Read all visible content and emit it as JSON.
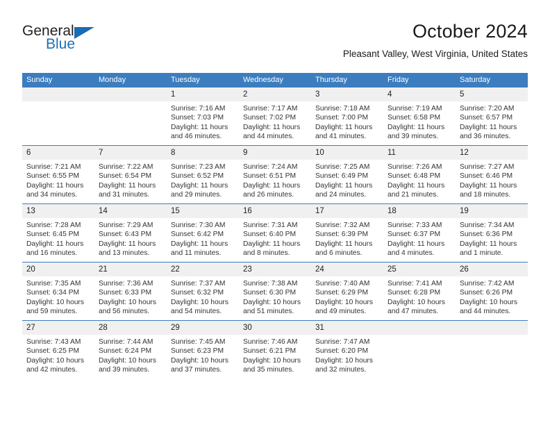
{
  "brand": {
    "name_top": "General",
    "name_bottom": "Blue",
    "triangle_icon": "blue-triangle-logo-icon",
    "accent_color": "#1b6cb3"
  },
  "header": {
    "title": "October 2024",
    "subtitle": "Pleasant Valley, West Virginia, United States"
  },
  "calendar": {
    "header_bg": "#3b7dbf",
    "daynum_bg": "#f0f0f0",
    "weekdays": [
      "Sunday",
      "Monday",
      "Tuesday",
      "Wednesday",
      "Thursday",
      "Friday",
      "Saturday"
    ],
    "weeks": [
      [
        {
          "day": "",
          "empty": true,
          "l1": "",
          "l2": "",
          "l3": "",
          "l4": ""
        },
        {
          "day": "",
          "empty": true,
          "l1": "",
          "l2": "",
          "l3": "",
          "l4": ""
        },
        {
          "day": "1",
          "l1": "Sunrise: 7:16 AM",
          "l2": "Sunset: 7:03 PM",
          "l3": "Daylight: 11 hours",
          "l4": "and 46 minutes."
        },
        {
          "day": "2",
          "l1": "Sunrise: 7:17 AM",
          "l2": "Sunset: 7:02 PM",
          "l3": "Daylight: 11 hours",
          "l4": "and 44 minutes."
        },
        {
          "day": "3",
          "l1": "Sunrise: 7:18 AM",
          "l2": "Sunset: 7:00 PM",
          "l3": "Daylight: 11 hours",
          "l4": "and 41 minutes."
        },
        {
          "day": "4",
          "l1": "Sunrise: 7:19 AM",
          "l2": "Sunset: 6:58 PM",
          "l3": "Daylight: 11 hours",
          "l4": "and 39 minutes."
        },
        {
          "day": "5",
          "l1": "Sunrise: 7:20 AM",
          "l2": "Sunset: 6:57 PM",
          "l3": "Daylight: 11 hours",
          "l4": "and 36 minutes."
        }
      ],
      [
        {
          "day": "6",
          "l1": "Sunrise: 7:21 AM",
          "l2": "Sunset: 6:55 PM",
          "l3": "Daylight: 11 hours",
          "l4": "and 34 minutes."
        },
        {
          "day": "7",
          "l1": "Sunrise: 7:22 AM",
          "l2": "Sunset: 6:54 PM",
          "l3": "Daylight: 11 hours",
          "l4": "and 31 minutes."
        },
        {
          "day": "8",
          "l1": "Sunrise: 7:23 AM",
          "l2": "Sunset: 6:52 PM",
          "l3": "Daylight: 11 hours",
          "l4": "and 29 minutes."
        },
        {
          "day": "9",
          "l1": "Sunrise: 7:24 AM",
          "l2": "Sunset: 6:51 PM",
          "l3": "Daylight: 11 hours",
          "l4": "and 26 minutes."
        },
        {
          "day": "10",
          "l1": "Sunrise: 7:25 AM",
          "l2": "Sunset: 6:49 PM",
          "l3": "Daylight: 11 hours",
          "l4": "and 24 minutes."
        },
        {
          "day": "11",
          "l1": "Sunrise: 7:26 AM",
          "l2": "Sunset: 6:48 PM",
          "l3": "Daylight: 11 hours",
          "l4": "and 21 minutes."
        },
        {
          "day": "12",
          "l1": "Sunrise: 7:27 AM",
          "l2": "Sunset: 6:46 PM",
          "l3": "Daylight: 11 hours",
          "l4": "and 18 minutes."
        }
      ],
      [
        {
          "day": "13",
          "l1": "Sunrise: 7:28 AM",
          "l2": "Sunset: 6:45 PM",
          "l3": "Daylight: 11 hours",
          "l4": "and 16 minutes."
        },
        {
          "day": "14",
          "l1": "Sunrise: 7:29 AM",
          "l2": "Sunset: 6:43 PM",
          "l3": "Daylight: 11 hours",
          "l4": "and 13 minutes."
        },
        {
          "day": "15",
          "l1": "Sunrise: 7:30 AM",
          "l2": "Sunset: 6:42 PM",
          "l3": "Daylight: 11 hours",
          "l4": "and 11 minutes."
        },
        {
          "day": "16",
          "l1": "Sunrise: 7:31 AM",
          "l2": "Sunset: 6:40 PM",
          "l3": "Daylight: 11 hours",
          "l4": "and 8 minutes."
        },
        {
          "day": "17",
          "l1": "Sunrise: 7:32 AM",
          "l2": "Sunset: 6:39 PM",
          "l3": "Daylight: 11 hours",
          "l4": "and 6 minutes."
        },
        {
          "day": "18",
          "l1": "Sunrise: 7:33 AM",
          "l2": "Sunset: 6:37 PM",
          "l3": "Daylight: 11 hours",
          "l4": "and 4 minutes."
        },
        {
          "day": "19",
          "l1": "Sunrise: 7:34 AM",
          "l2": "Sunset: 6:36 PM",
          "l3": "Daylight: 11 hours",
          "l4": "and 1 minute."
        }
      ],
      [
        {
          "day": "20",
          "l1": "Sunrise: 7:35 AM",
          "l2": "Sunset: 6:34 PM",
          "l3": "Daylight: 10 hours",
          "l4": "and 59 minutes."
        },
        {
          "day": "21",
          "l1": "Sunrise: 7:36 AM",
          "l2": "Sunset: 6:33 PM",
          "l3": "Daylight: 10 hours",
          "l4": "and 56 minutes."
        },
        {
          "day": "22",
          "l1": "Sunrise: 7:37 AM",
          "l2": "Sunset: 6:32 PM",
          "l3": "Daylight: 10 hours",
          "l4": "and 54 minutes."
        },
        {
          "day": "23",
          "l1": "Sunrise: 7:38 AM",
          "l2": "Sunset: 6:30 PM",
          "l3": "Daylight: 10 hours",
          "l4": "and 51 minutes."
        },
        {
          "day": "24",
          "l1": "Sunrise: 7:40 AM",
          "l2": "Sunset: 6:29 PM",
          "l3": "Daylight: 10 hours",
          "l4": "and 49 minutes."
        },
        {
          "day": "25",
          "l1": "Sunrise: 7:41 AM",
          "l2": "Sunset: 6:28 PM",
          "l3": "Daylight: 10 hours",
          "l4": "and 47 minutes."
        },
        {
          "day": "26",
          "l1": "Sunrise: 7:42 AM",
          "l2": "Sunset: 6:26 PM",
          "l3": "Daylight: 10 hours",
          "l4": "and 44 minutes."
        }
      ],
      [
        {
          "day": "27",
          "l1": "Sunrise: 7:43 AM",
          "l2": "Sunset: 6:25 PM",
          "l3": "Daylight: 10 hours",
          "l4": "and 42 minutes."
        },
        {
          "day": "28",
          "l1": "Sunrise: 7:44 AM",
          "l2": "Sunset: 6:24 PM",
          "l3": "Daylight: 10 hours",
          "l4": "and 39 minutes."
        },
        {
          "day": "29",
          "l1": "Sunrise: 7:45 AM",
          "l2": "Sunset: 6:23 PM",
          "l3": "Daylight: 10 hours",
          "l4": "and 37 minutes."
        },
        {
          "day": "30",
          "l1": "Sunrise: 7:46 AM",
          "l2": "Sunset: 6:21 PM",
          "l3": "Daylight: 10 hours",
          "l4": "and 35 minutes."
        },
        {
          "day": "31",
          "l1": "Sunrise: 7:47 AM",
          "l2": "Sunset: 6:20 PM",
          "l3": "Daylight: 10 hours",
          "l4": "and 32 minutes."
        },
        {
          "day": "",
          "empty": true,
          "l1": "",
          "l2": "",
          "l3": "",
          "l4": ""
        },
        {
          "day": "",
          "empty": true,
          "l1": "",
          "l2": "",
          "l3": "",
          "l4": ""
        }
      ]
    ]
  }
}
